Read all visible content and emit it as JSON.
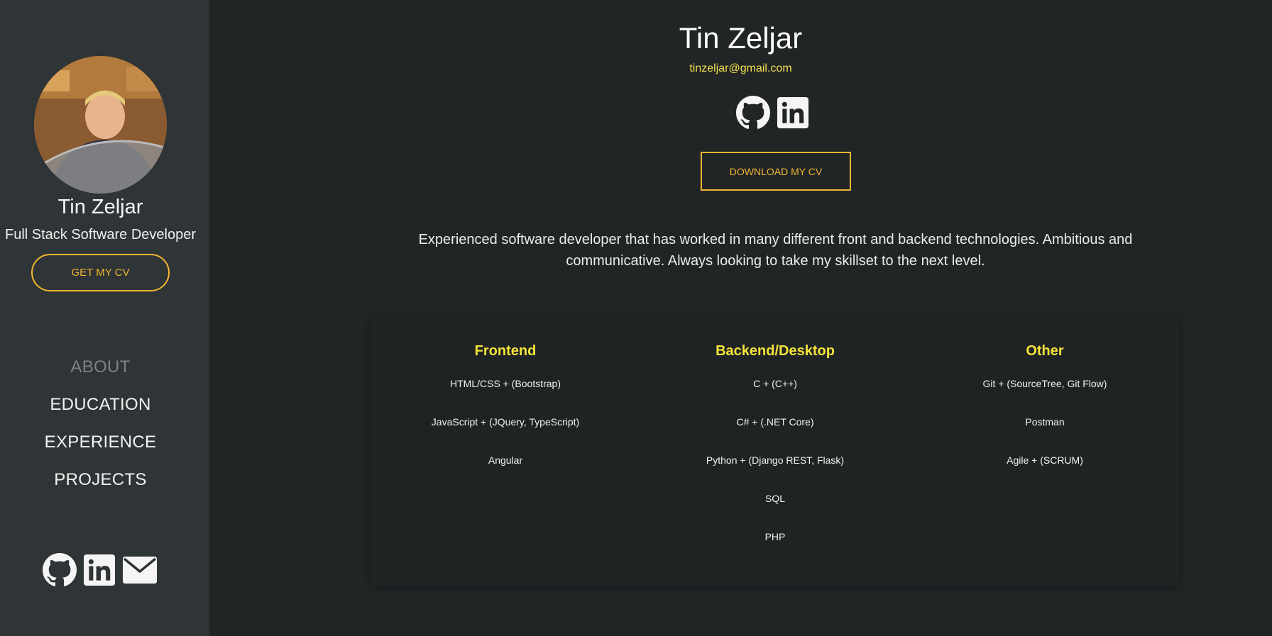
{
  "sidebar": {
    "name": "Tin Zeljar",
    "role": "Full Stack Software Developer",
    "cv_button": "GET MY CV",
    "nav": [
      {
        "label": "ABOUT",
        "active": true
      },
      {
        "label": "EDUCATION",
        "active": false
      },
      {
        "label": "EXPERIENCE",
        "active": false
      },
      {
        "label": "PROJECTS",
        "active": false
      }
    ],
    "social_icons": [
      "github-icon",
      "linkedin-icon",
      "envelope-icon"
    ]
  },
  "main": {
    "name": "Tin Zeljar",
    "email": "tinzeljar@gmail.com",
    "social_icons": [
      "github-icon",
      "linkedin-icon"
    ],
    "download_button": "DOWNLOAD MY CV",
    "bio": "Experienced software developer that has worked in many different front and backend technologies. Ambitious and communicative. Always looking to take my skillset to the next level."
  },
  "skills": [
    {
      "title": "Frontend",
      "items": [
        "HTML/CSS + (Bootstrap)",
        "JavaScript + (JQuery, TypeScript)",
        "Angular"
      ]
    },
    {
      "title": "Backend/Desktop",
      "items": [
        "C + (C++)",
        "C# + (.NET Core)",
        "Python + (Django REST, Flask)",
        "SQL",
        "PHP"
      ]
    },
    {
      "title": "Other",
      "items": [
        "Git + (SourceTree, Git Flow)",
        "Postman",
        "Agile + (SCRUM)"
      ]
    }
  ],
  "colors": {
    "accent": "#f2b632",
    "heading_yellow": "#f5e43a",
    "sidebar_bg": "#2f3436",
    "page_bg": "#212526"
  }
}
